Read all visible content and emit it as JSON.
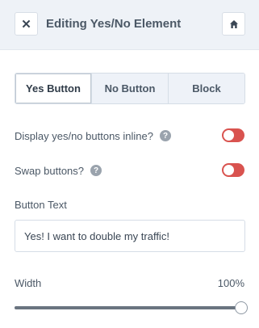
{
  "header": {
    "close_icon": "close-icon",
    "close_glyph": "✕",
    "title": "Editing Yes/No Element",
    "home_icon": "home-icon"
  },
  "tabs": [
    {
      "label": "Yes Button",
      "active": true
    },
    {
      "label": "No Button",
      "active": false
    },
    {
      "label": "Block",
      "active": false
    }
  ],
  "settings": {
    "inline": {
      "label": "Display yes/no buttons inline?",
      "help_glyph": "?",
      "enabled": true
    },
    "swap": {
      "label": "Swap buttons?",
      "help_glyph": "?",
      "enabled": true
    }
  },
  "button_text": {
    "label": "Button Text",
    "value": "Yes! I want to double my traffic!"
  },
  "width": {
    "label": "Width",
    "value_text": "100%",
    "value": 100
  },
  "colors": {
    "toggle_on": "#d9534f",
    "header_bg": "#eef2f7"
  }
}
